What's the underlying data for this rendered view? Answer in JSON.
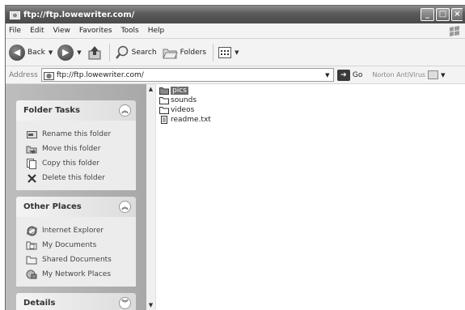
{
  "window": {
    "title": "ftp://ftp.lowewriter.com/"
  },
  "menu": [
    "File",
    "Edit",
    "View",
    "Favorites",
    "Tools",
    "Help"
  ],
  "toolbar": {
    "back": "Back",
    "search": "Search",
    "folders": "Folders"
  },
  "address": {
    "label": "Address",
    "value": "ftp://ftp.lowewriter.com/",
    "go": "Go",
    "norton": "Norton AntiVirus"
  },
  "folder_tasks": {
    "title": "Folder Tasks",
    "items": [
      "Rename this folder",
      "Move this folder",
      "Copy this folder",
      "Delete this folder"
    ]
  },
  "other_places": {
    "title": "Other Places",
    "items": [
      "Internet Explorer",
      "My Documents",
      "Shared Documents",
      "My Network Places"
    ]
  },
  "details": {
    "title": "Details"
  },
  "files": [
    {
      "name": "pics",
      "type": "folder",
      "selected": true
    },
    {
      "name": "sounds",
      "type": "folder",
      "selected": false
    },
    {
      "name": "videos",
      "type": "folder",
      "selected": false
    },
    {
      "name": "readme.txt",
      "type": "text",
      "selected": false
    }
  ]
}
